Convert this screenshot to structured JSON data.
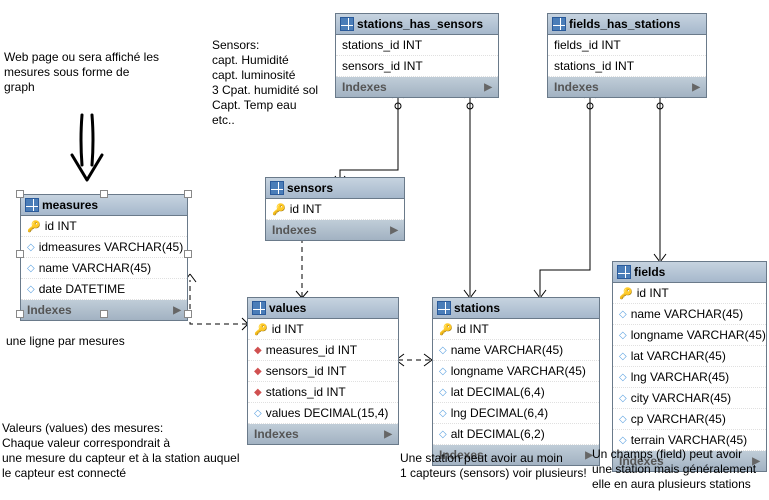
{
  "chart_data": {
    "type": "table",
    "entities": [
      {
        "name": "measures",
        "columns": [
          {
            "name": "id",
            "type": "INT",
            "pk": true
          },
          {
            "name": "idmeasures",
            "type": "VARCHAR(45)"
          },
          {
            "name": "name",
            "type": "VARCHAR(45)"
          },
          {
            "name": "date",
            "type": "DATETIME"
          }
        ]
      },
      {
        "name": "sensors",
        "columns": [
          {
            "name": "id",
            "type": "INT",
            "pk": true
          }
        ]
      },
      {
        "name": "values",
        "columns": [
          {
            "name": "id",
            "type": "INT",
            "pk": true
          },
          {
            "name": "measures_id",
            "type": "INT",
            "fk": true
          },
          {
            "name": "sensors_id",
            "type": "INT",
            "fk": true
          },
          {
            "name": "stations_id",
            "type": "INT",
            "fk": true
          },
          {
            "name": "values",
            "type": "DECIMAL(15,4)"
          }
        ]
      },
      {
        "name": "stations",
        "columns": [
          {
            "name": "id",
            "type": "INT",
            "pk": true
          },
          {
            "name": "name",
            "type": "VARCHAR(45)"
          },
          {
            "name": "longname",
            "type": "VARCHAR(45)"
          },
          {
            "name": "lat",
            "type": "DECIMAL(6,4)"
          },
          {
            "name": "lng",
            "type": "DECIMAL(6,4)"
          },
          {
            "name": "alt",
            "type": "DECIMAL(6,2)"
          }
        ]
      },
      {
        "name": "stations_has_sensors",
        "columns": [
          {
            "name": "stations_id",
            "type": "INT",
            "fk": true
          },
          {
            "name": "sensors_id",
            "type": "INT",
            "fk": true
          }
        ]
      },
      {
        "name": "fields_has_stations",
        "columns": [
          {
            "name": "fields_id",
            "type": "INT",
            "fk": true
          },
          {
            "name": "stations_id",
            "type": "INT",
            "fk": true
          }
        ]
      },
      {
        "name": "fields",
        "columns": [
          {
            "name": "id",
            "type": "INT",
            "pk": true
          },
          {
            "name": "name",
            "type": "VARCHAR(45)"
          },
          {
            "name": "longname",
            "type": "VARCHAR(45)"
          },
          {
            "name": "lat",
            "type": "VARCHAR(45)"
          },
          {
            "name": "lng",
            "type": "VARCHAR(45)"
          },
          {
            "name": "city",
            "type": "VARCHAR(45)"
          },
          {
            "name": "cp",
            "type": "VARCHAR(45)"
          },
          {
            "name": "terrain",
            "type": "VARCHAR(45)"
          }
        ]
      }
    ],
    "relationships": [
      {
        "from": "values.measures_id",
        "to": "measures.id",
        "type": "many-to-one",
        "dashed": true
      },
      {
        "from": "values.sensors_id",
        "to": "sensors.id",
        "type": "many-to-one",
        "dashed": true
      },
      {
        "from": "values.stations_id",
        "to": "stations.id",
        "type": "many-to-one",
        "dashed": true
      },
      {
        "from": "stations_has_sensors.sensors_id",
        "to": "sensors.id",
        "type": "many-to-one",
        "dashed": false
      },
      {
        "from": "stations_has_sensors.stations_id",
        "to": "stations.id",
        "type": "many-to-one",
        "dashed": false
      },
      {
        "from": "fields_has_stations.stations_id",
        "to": "stations.id",
        "type": "many-to-one",
        "dashed": false
      },
      {
        "from": "fields_has_stations.fields_id",
        "to": "fields.id",
        "type": "many-to-one",
        "dashed": false
      }
    ]
  },
  "tables": {
    "measures": {
      "title": "measures",
      "cols": {
        "id": "id INT",
        "idmeasures": "idmeasures VARCHAR(45)",
        "name": "name VARCHAR(45)",
        "date": "date DATETIME"
      },
      "indexes": "Indexes"
    },
    "sensors": {
      "title": "sensors",
      "cols": {
        "id": "id INT"
      },
      "indexes": "Indexes"
    },
    "values": {
      "title": "values",
      "cols": {
        "id": "id INT",
        "measures_id": "measures_id INT",
        "sensors_id": "sensors_id INT",
        "stations_id": "stations_id INT",
        "values": "values DECIMAL(15,4)"
      },
      "indexes": "Indexes"
    },
    "stations": {
      "title": "stations",
      "cols": {
        "id": "id INT",
        "name": "name VARCHAR(45)",
        "longname": "longname VARCHAR(45)",
        "lat": "lat DECIMAL(6,4)",
        "lng": "lng DECIMAL(6,4)",
        "alt": "alt DECIMAL(6,2)"
      },
      "indexes": "Indexes"
    },
    "stations_has_sensors": {
      "title": "stations_has_sensors",
      "cols": {
        "stations_id": "stations_id INT",
        "sensors_id": "sensors_id INT"
      },
      "indexes": "Indexes"
    },
    "fields_has_stations": {
      "title": "fields_has_stations",
      "cols": {
        "fields_id": "fields_id INT",
        "stations_id": "stations_id INT"
      },
      "indexes": "Indexes"
    },
    "fields": {
      "title": "fields",
      "cols": {
        "id": "id INT",
        "name": "name VARCHAR(45)",
        "longname": "longname VARCHAR(45)",
        "lat": "lat VARCHAR(45)",
        "lng": "lng VARCHAR(45)",
        "city": "city VARCHAR(45)",
        "cp": "cp VARCHAR(45)",
        "terrain": "terrain VARCHAR(45)"
      },
      "indexes": "Indexes"
    }
  },
  "annotations": {
    "webpage": "Web page ou sera affiché les\nmesures sous forme de\ngraph",
    "sensors": "Sensors:\ncapt. Humidité\ncapt. luminosité\n3 Cpat. humidité sol\nCapt. Temp eau\netc..",
    "measures_note": "une ligne par mesures",
    "values_note": "Valeurs  (values) des mesures:\nChaque valeur correspondrait à\nune mesure du capteur et à la station auquel\nle capteur est connecté",
    "stations_note": "Une station peut avoir au moin\n1 capteurs (sensors) voir plusieurs!",
    "fields_note": "Un champs (field) peut avoir\nune station mais généralement\nelle en aura plusieurs stations"
  }
}
